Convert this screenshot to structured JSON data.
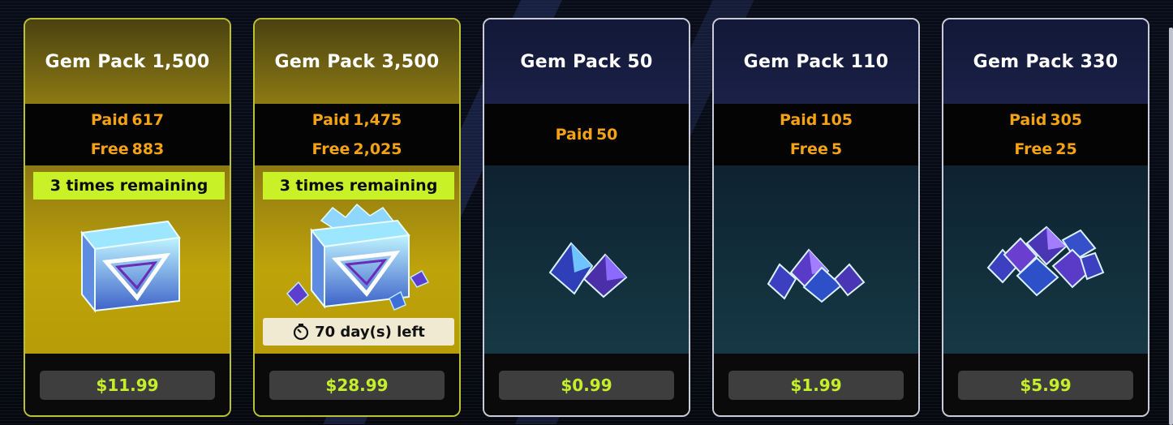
{
  "packs": [
    {
      "title": "Gem Pack 1,500",
      "style": "gold",
      "paid_label": "Paid",
      "paid_value": "617",
      "free_label": "Free",
      "free_value": "883",
      "remaining": "3 times remaining",
      "art": "gem-chest-icon",
      "price": "$11.99"
    },
    {
      "title": "Gem Pack 3,500",
      "style": "gold",
      "paid_label": "Paid",
      "paid_value": "1,475",
      "free_label": "Free",
      "free_value": "2,025",
      "remaining": "3 times remaining",
      "art": "overflowing-gem-chest-icon",
      "timer_icon": "stopwatch-icon",
      "timer": "70 day(s) left",
      "price": "$28.99"
    },
    {
      "title": "Gem Pack 50",
      "style": "blue",
      "paid_label": "Paid",
      "paid_value": "50",
      "art": "two-gems-icon",
      "price": "$0.99"
    },
    {
      "title": "Gem Pack 110",
      "style": "blue",
      "paid_label": "Paid",
      "paid_value": "105",
      "free_label": "Free",
      "free_value": "5",
      "art": "gem-pile-small-icon",
      "price": "$1.99"
    },
    {
      "title": "Gem Pack 330",
      "style": "blue",
      "paid_label": "Paid",
      "paid_value": "305",
      "free_label": "Free",
      "free_value": "25",
      "art": "gem-pile-large-icon",
      "price": "$5.99"
    }
  ],
  "colors": {
    "accent_gold": "#b8c232",
    "paid_free_text": "#f5a315",
    "price_text": "#c5ef2a",
    "remaining_badge": "#c8f227",
    "blue_border": "#c9ccd8"
  }
}
